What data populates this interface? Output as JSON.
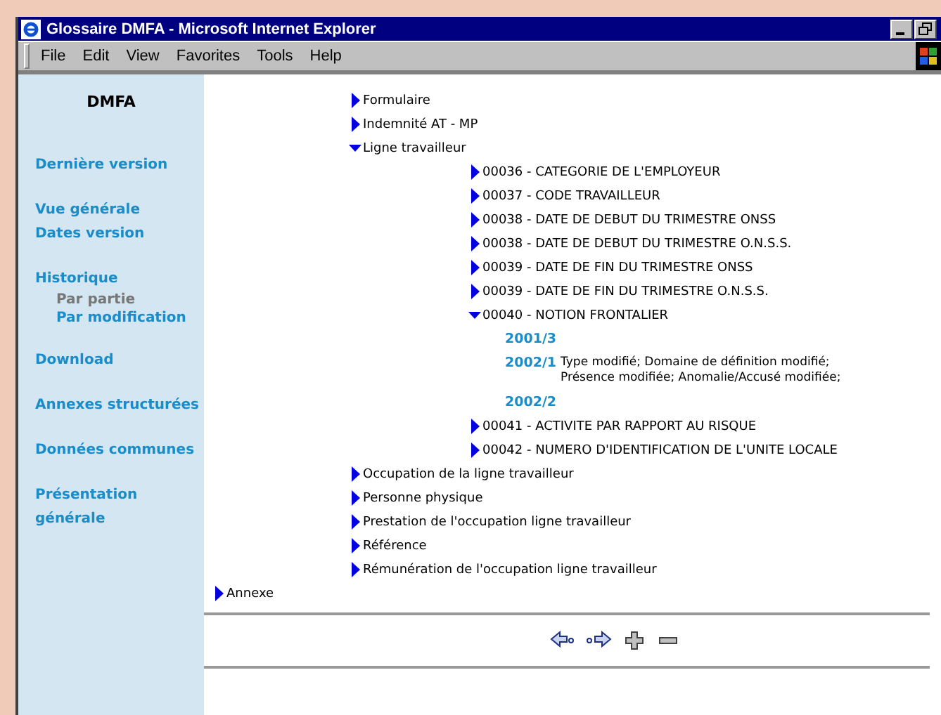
{
  "window": {
    "title": "Glossaire DMFA - Microsoft Internet Explorer"
  },
  "menu": [
    "File",
    "Edit",
    "View",
    "Favorites",
    "Tools",
    "Help"
  ],
  "sidebar": {
    "title": "DMFA",
    "sections": [
      {
        "items": [
          {
            "label": "Dernière version",
            "selected": false
          }
        ]
      },
      {
        "items": [
          {
            "label": "Vue générale",
            "selected": false
          },
          {
            "label": "Dates version",
            "selected": false
          }
        ]
      },
      {
        "items": [
          {
            "label": "Historique",
            "selected": false,
            "children": [
              {
                "label": "Par partie",
                "selected": true
              },
              {
                "label": "Par modification",
                "selected": false
              }
            ]
          }
        ]
      },
      {
        "items": [
          {
            "label": "Download",
            "selected": false
          }
        ]
      },
      {
        "items": [
          {
            "label": "Annexes structurées",
            "selected": false
          }
        ]
      },
      {
        "items": [
          {
            "label": "Données communes",
            "selected": false
          }
        ]
      },
      {
        "items": [
          {
            "label": "Présentation générale",
            "selected": false
          }
        ]
      }
    ]
  },
  "tree_branch": [
    {
      "kind": "node",
      "label": "Formulaire",
      "expanded": false
    },
    {
      "kind": "node",
      "label": "Indemnité AT - MP",
      "expanded": false
    },
    {
      "kind": "node",
      "label": "Ligne travailleur",
      "expanded": true,
      "children": [
        {
          "kind": "node",
          "label": "00036 - CATEGORIE DE L'EMPLOYEUR",
          "expanded": false
        },
        {
          "kind": "node",
          "label": "00037 - CODE TRAVAILLEUR",
          "expanded": false
        },
        {
          "kind": "node",
          "label": "00038 - DATE DE DEBUT DU TRIMESTRE ONSS",
          "expanded": false
        },
        {
          "kind": "node",
          "label": "00038 - DATE DE DEBUT DU TRIMESTRE O.N.S.S.",
          "expanded": false
        },
        {
          "kind": "node",
          "label": "00039 - DATE DE FIN DU TRIMESTRE ONSS",
          "expanded": false
        },
        {
          "kind": "node",
          "label": "00039 - DATE DE FIN DU TRIMESTRE O.N.S.S.",
          "expanded": false
        },
        {
          "kind": "node",
          "label": "00040 - NOTION FRONTALIER",
          "expanded": true,
          "children": [
            {
              "kind": "version",
              "label": "2001/3"
            },
            {
              "kind": "version",
              "label": "2002/1",
              "note": "Type modifié; Domaine de définition modifié; Présence modifiée; Anomalie/Accusé modifiée;"
            },
            {
              "kind": "version",
              "label": "2002/2"
            }
          ]
        },
        {
          "kind": "node",
          "label": "00041 - ACTIVITE PAR RAPPORT AU RISQUE",
          "expanded": false
        },
        {
          "kind": "node",
          "label": "00042 - NUMERO D'IDENTIFICATION DE L'UNITE LOCALE",
          "expanded": false
        }
      ]
    },
    {
      "kind": "node",
      "label": "Occupation de la ligne travailleur",
      "expanded": false
    },
    {
      "kind": "node",
      "label": "Personne physique",
      "expanded": false
    },
    {
      "kind": "node",
      "label": "Prestation de l'occupation ligne travailleur",
      "expanded": false
    },
    {
      "kind": "node",
      "label": "Référence",
      "expanded": false
    },
    {
      "kind": "node",
      "label": "Rémunération de l'occupation ligne travailleur",
      "expanded": false
    }
  ],
  "tree_top": [
    {
      "kind": "node",
      "label": "Annexe",
      "expanded": false
    }
  ],
  "navigation": [
    {
      "kind": "back"
    },
    {
      "kind": "forward"
    },
    {
      "kind": "expand"
    },
    {
      "kind": "collapse"
    }
  ]
}
